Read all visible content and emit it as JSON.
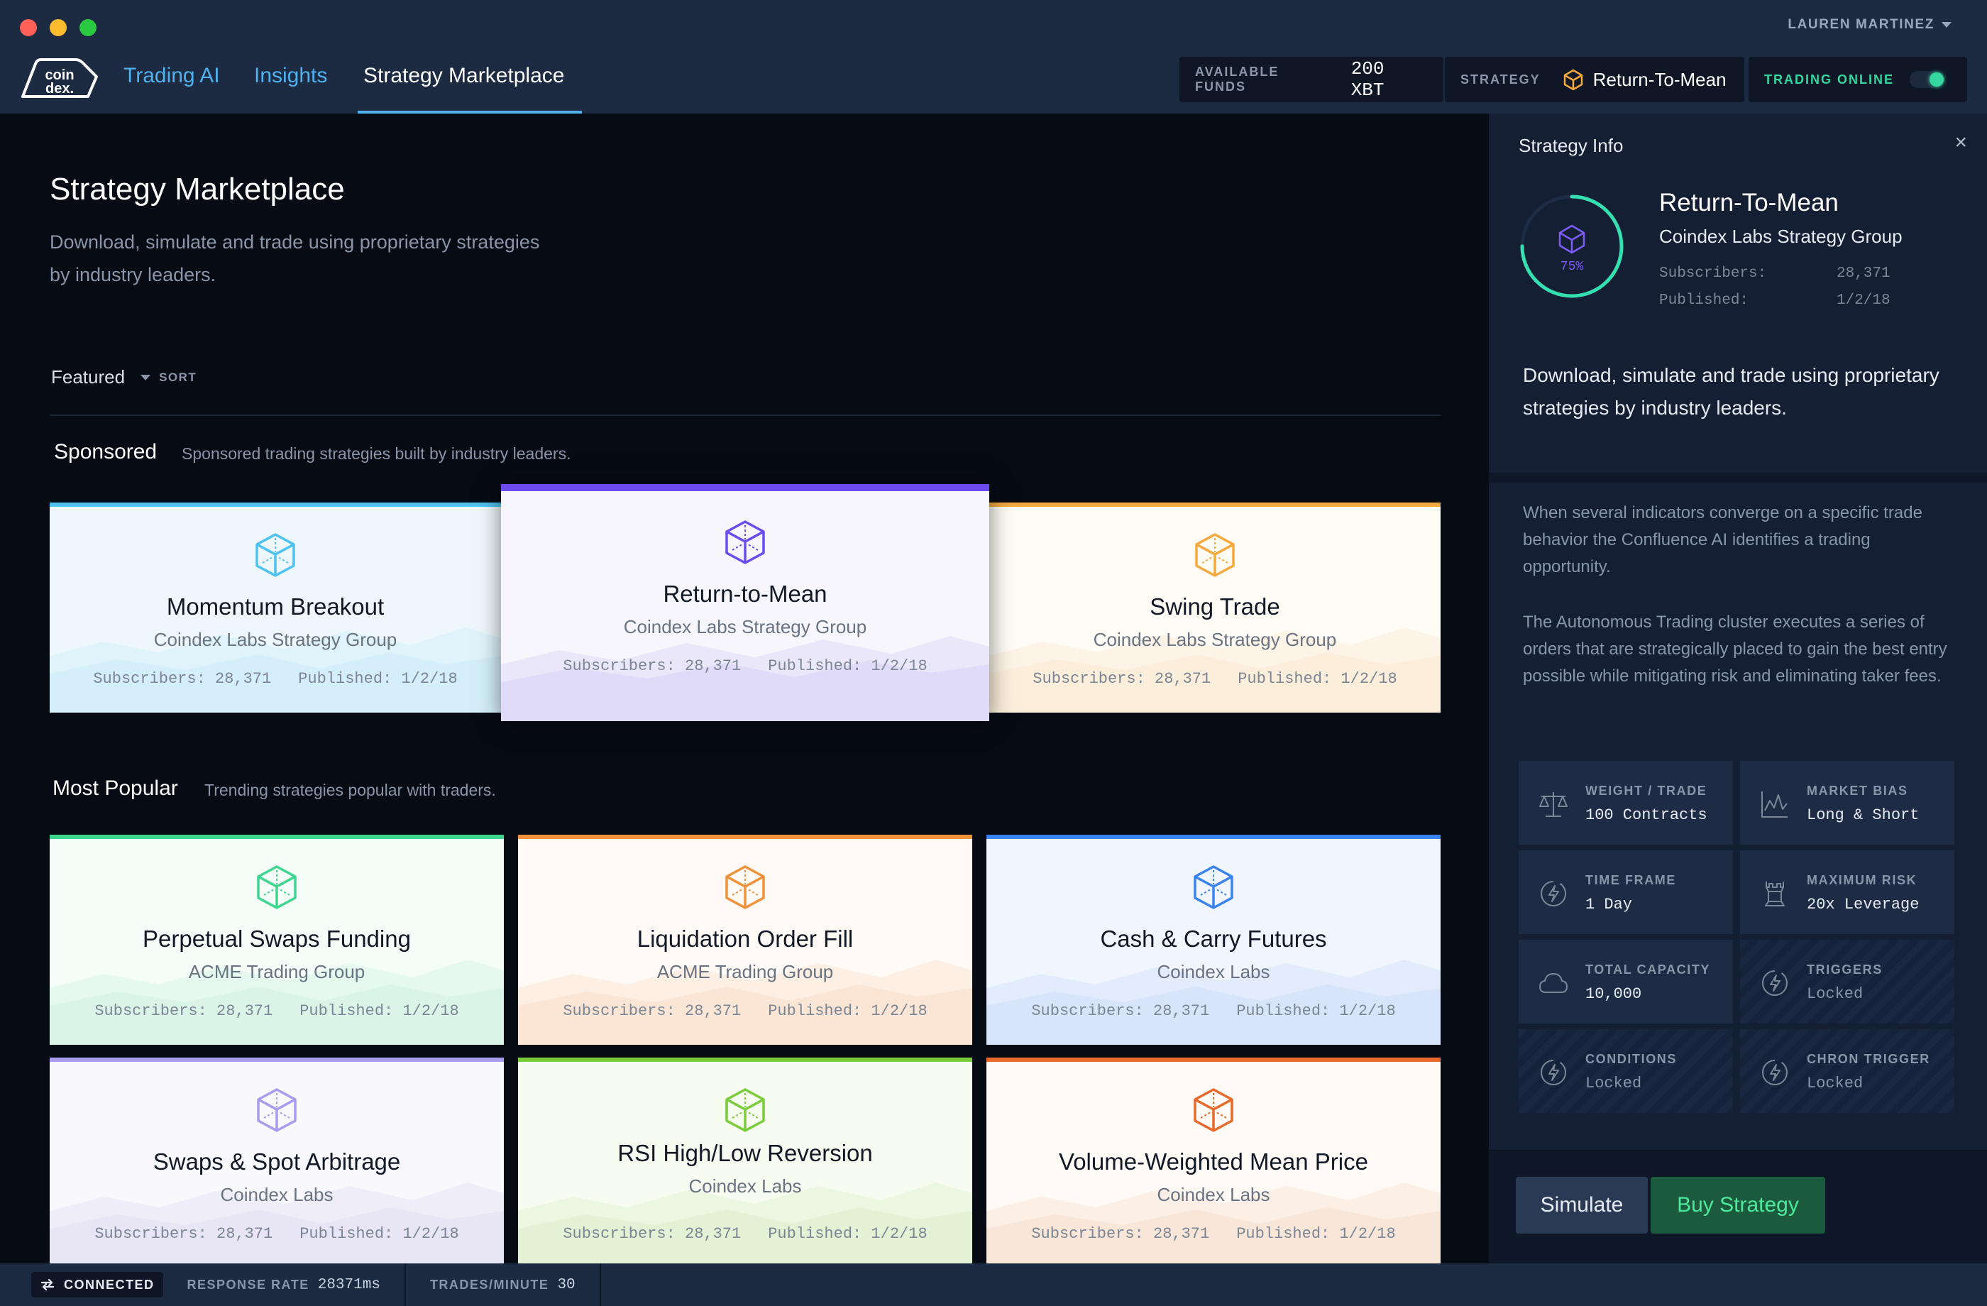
{
  "user": {
    "name": "LAUREN MARTINEZ"
  },
  "logo": {
    "line1": "coin",
    "line2": "dex."
  },
  "nav": [
    {
      "label": "Trading AI"
    },
    {
      "label": "Insights"
    },
    {
      "label": "Strategy Marketplace",
      "active": true
    }
  ],
  "header": {
    "funds_label": "AVAILABLE FUNDS",
    "funds_value": "200 XBT",
    "strategy_label": "STRATEGY",
    "strategy_value": "Return-To-Mean",
    "trading_label": "TRADING ONLINE",
    "trading_on": true
  },
  "page": {
    "title": "Strategy Marketplace",
    "subtitle": "Download, simulate and trade using proprietary strategies by industry leaders.",
    "sort_value": "Featured",
    "sort_label": "SORT"
  },
  "sections": {
    "sponsored": {
      "title": "Sponsored",
      "subtitle": "Sponsored trading strategies built by industry leaders."
    },
    "popular": {
      "title": "Most Popular",
      "subtitle": "Trending strategies popular with traders."
    }
  },
  "sponsored_cards": [
    {
      "title": "Momentum Breakout",
      "org": "Coindex Labs Strategy Group",
      "subscribers": "Subscribers: 28,371",
      "published": "Published: 1/2/18",
      "accent": "#4cc3f0",
      "tint": "#d4eff9"
    },
    {
      "title": "Return-to-Mean",
      "org": "Coindex Labs Strategy Group",
      "subscribers": "Subscribers: 28,371",
      "published": "Published: 1/2/18",
      "accent": "#6a4cf0",
      "tint": "#e1dbfa"
    },
    {
      "title": "Swing Trade",
      "org": "Coindex Labs Strategy Group",
      "subscribers": "Subscribers: 28,371",
      "published": "Published: 1/2/18",
      "accent": "#f5a93c",
      "tint": "#fbeedb"
    }
  ],
  "popular_cards": [
    {
      "title": "Perpetual Swaps Funding",
      "org": "ACME Trading Group",
      "subscribers": "Subscribers: 28,371",
      "published": "Published: 1/2/18",
      "accent": "#3fd68f",
      "tint": "#daf5e8"
    },
    {
      "title": "Liquidation Order Fill",
      "org": "ACME Trading Group",
      "subscribers": "Subscribers: 28,371",
      "published": "Published: 1/2/18",
      "accent": "#f0923a",
      "tint": "#fbe6d6"
    },
    {
      "title": "Cash & Carry Futures",
      "org": "Coindex Labs",
      "subscribers": "Subscribers: 28,371",
      "published": "Published: 1/2/18",
      "accent": "#3b84f0",
      "tint": "#d7e4f9"
    },
    {
      "title": "Swaps & Spot Arbitrage",
      "org": "Coindex Labs",
      "subscribers": "Subscribers: 28,371",
      "published": "Published: 1/2/18",
      "accent": "#a99cf0",
      "tint": "#e8e5f4"
    },
    {
      "title": "RSI High/Low Reversion",
      "org": "Coindex Labs",
      "subscribers": "Subscribers: 28,371",
      "published": "Published: 1/2/18",
      "accent": "#79cc3a",
      "tint": "#e3f2d5"
    },
    {
      "title": "Volume-Weighted Mean Price",
      "org": "Coindex Labs",
      "subscribers": "Subscribers: 28,371",
      "published": "Published: 1/2/18",
      "accent": "#e8692a",
      "tint": "#f8e6d9"
    }
  ],
  "info": {
    "panel_title": "Strategy Info",
    "name": "Return-To-Mean",
    "group": "Coindex Labs Strategy Group",
    "progress_label": "75%",
    "progress": 0.75,
    "subscribers_label": "Subscribers:",
    "subscribers_value": "28,371",
    "published_label": "Published:",
    "published_value": "1/2/18",
    "description": "Download, simulate and trade using proprietary strategies by industry leaders.",
    "para1": "When several indicators converge on a specific trade behavior the Confluence AI identifies a trading opportunity.",
    "para2": "The Autonomous Trading cluster executes a series of orders that are strategically placed to gain the best entry possible while mitigating risk and eliminating taker fees.",
    "stats": [
      {
        "label": "WEIGHT / TRADE",
        "value": "100 Contracts",
        "icon": "scale-icon",
        "locked": false
      },
      {
        "label": "MARKET BIAS",
        "value": "Long & Short",
        "icon": "chart-line-icon",
        "locked": false
      },
      {
        "label": "TIME FRAME",
        "value": "1 Day",
        "icon": "bolt-circle-icon",
        "locked": false
      },
      {
        "label": "MAXIMUM RISK",
        "value": "20x Leverage",
        "icon": "rook-icon",
        "locked": false
      },
      {
        "label": "TOTAL CAPACITY",
        "value": "10,000",
        "icon": "cloud-icon",
        "locked": false
      },
      {
        "label": "TRIGGERS",
        "value": "Locked",
        "icon": "bolt-circle-icon",
        "locked": true
      },
      {
        "label": "CONDITIONS",
        "value": "Locked",
        "icon": "bolt-circle-icon",
        "locked": true
      },
      {
        "label": "CHRON TRIGGER",
        "value": "Locked",
        "icon": "bolt-circle-icon",
        "locked": true
      }
    ],
    "simulate_label": "Simulate",
    "buy_label": "Buy Strategy"
  },
  "status": {
    "connected": "CONNECTED",
    "response_label": "RESPONSE RATE",
    "response_value": "28371ms",
    "trades_label": "TRADES/MINUTE",
    "trades_value": "30"
  }
}
